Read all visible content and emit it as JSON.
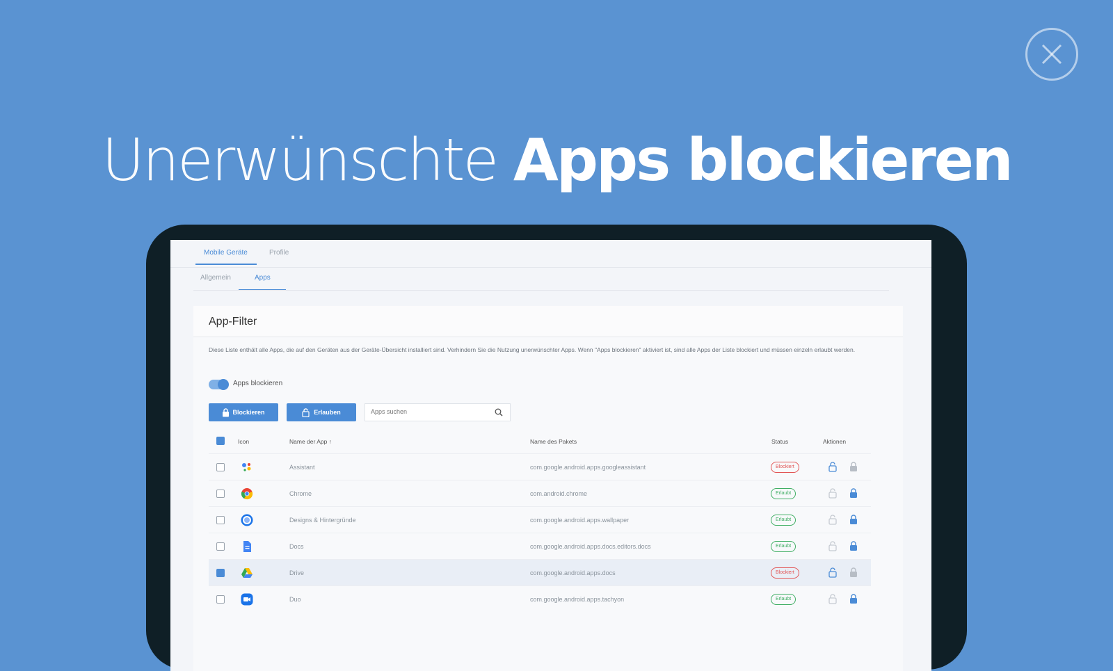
{
  "headline": {
    "light": "Unerwünschte",
    "bold": "Apps blockieren"
  },
  "close_icon": "close-icon",
  "screen": {
    "top_tabs": [
      {
        "label": "Mobile Geräte"
      },
      {
        "label": "Profile"
      }
    ],
    "sub_tabs": [
      {
        "label": "Allgemein"
      },
      {
        "label": "Apps"
      }
    ],
    "card": {
      "title": "App-Filter",
      "description": "Diese Liste enthält alle Apps, die auf den Geräten aus der Geräte-Übersicht installiert sind. Verhindern Sie die Nutzung unerwünschter Apps. Wenn \"Apps blockieren\" aktiviert ist, sind alle Apps der Liste blockiert und müssen einzeln erlaubt werden.",
      "toggle_label": "Apps blockieren",
      "block_button": "Blockieren",
      "allow_button": "Erlauben",
      "search_placeholder": "Apps suchen",
      "columns": {
        "icon": "Icon",
        "name": "Name der App",
        "package": "Name des Pakets",
        "status": "Status",
        "actions": "Aktionen"
      },
      "rows": [
        {
          "name": "Assistant",
          "package": "com.google.android.apps.googleassistant",
          "status": "Blockiert",
          "checked": false
        },
        {
          "name": "Chrome",
          "package": "com.android.chrome",
          "status": "Erlaubt",
          "checked": false
        },
        {
          "name": "Designs & Hintergründe",
          "package": "com.google.android.apps.wallpaper",
          "status": "Erlaubt",
          "checked": false
        },
        {
          "name": "Docs",
          "package": "com.google.android.apps.docs.editors.docs",
          "status": "Erlaubt",
          "checked": false
        },
        {
          "name": "Drive",
          "package": "com.google.android.apps.docs",
          "status": "Blockiert",
          "checked": true
        },
        {
          "name": "Duo",
          "package": "com.google.android.apps.tachyon",
          "status": "Erlaubt",
          "checked": false
        }
      ]
    }
  },
  "colors": {
    "background": "#5a93d2",
    "accent": "#4a8bd6",
    "blocked": "#e25555",
    "allowed": "#3fae63"
  }
}
